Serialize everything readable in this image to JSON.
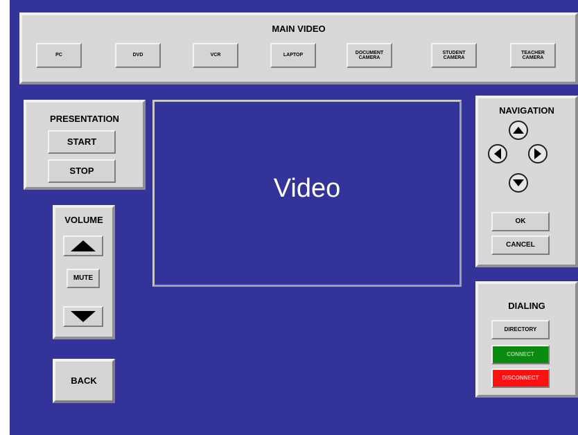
{
  "main_video": {
    "title": "MAIN VIDEO",
    "sources": [
      {
        "line1": "PC",
        "line2": ""
      },
      {
        "line1": "DVD",
        "line2": ""
      },
      {
        "line1": "VCR",
        "line2": ""
      },
      {
        "line1": "LAPTOP",
        "line2": ""
      },
      {
        "line1": "DOCUMENT",
        "line2": "CAMERA"
      },
      {
        "line1": "STUDENT",
        "line2": "CAMERA"
      },
      {
        "line1": "TEACHER",
        "line2": "CAMERA"
      }
    ]
  },
  "presentation": {
    "title": "PRESENTATION",
    "start": "START",
    "stop": "STOP"
  },
  "video": {
    "label": "Video"
  },
  "volume": {
    "title": "VOLUME",
    "mute": "MUTE"
  },
  "back": "BACK",
  "navigation": {
    "title": "NAVIGATION",
    "ok": "OK",
    "cancel": "CANCEL"
  },
  "dialing": {
    "title": "DIALING",
    "directory": "DIRECTORY",
    "connect": "CONNECT",
    "disconnect": "DISCONNECT"
  },
  "colors": {
    "background": "#333399",
    "panel": "#d8d8d8",
    "connect": "#0b8a12",
    "disconnect": "#ff1010"
  }
}
